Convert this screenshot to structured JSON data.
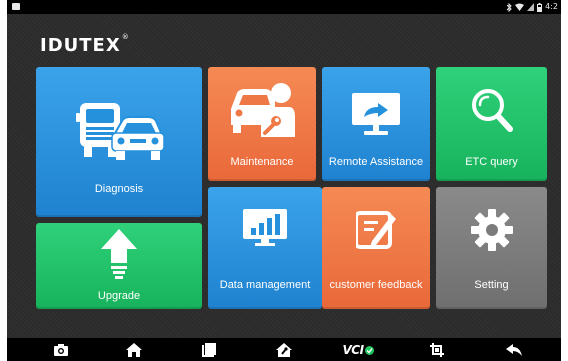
{
  "app": {
    "brand": "IDUTEX",
    "brand_mark": "®"
  },
  "status": {
    "time": "4:2",
    "icons": [
      "bluetooth-icon",
      "wifi-icon",
      "signal-icon",
      "battery-icon"
    ]
  },
  "tiles": {
    "diagnosis": "Diagnosis",
    "maintenance": "Maintenance",
    "remote_assistance": "Remote Assistance",
    "etc_query": "ETC query",
    "upgrade": "Upgrade",
    "data_management": "Data management",
    "customer_feedback": "customer feedback",
    "setting": "Setting"
  },
  "nav": {
    "vci_label": "VCI",
    "buttons": [
      "camera-icon",
      "home-icon",
      "recent-apps-icon",
      "home-settings-icon",
      "vci-icon",
      "crop-icon",
      "back-icon"
    ]
  },
  "colors": {
    "blue": "#2591dd",
    "orange": "#ef7847",
    "green": "#20c167",
    "gray": "#7c7c7c",
    "background": "#2b2b2b"
  }
}
